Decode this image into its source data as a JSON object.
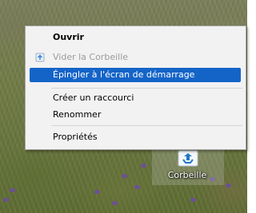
{
  "menu": {
    "items": [
      {
        "label": "Ouvrir"
      },
      {
        "label": "Vider la Corbeille"
      },
      {
        "label": "Épingler à l'écran de démarrage"
      },
      {
        "label": "Créer un raccourci"
      },
      {
        "label": "Renommer"
      },
      {
        "label": "Propriétés"
      }
    ],
    "icons": {
      "empty_bin": "recycle-bin-icon"
    },
    "highlight_color": "#1464c8",
    "disabled_color": "#9b9b9b"
  },
  "desktop": {
    "icon_label": "Corbeille",
    "icon_name": "recycle-bin-icon"
  }
}
